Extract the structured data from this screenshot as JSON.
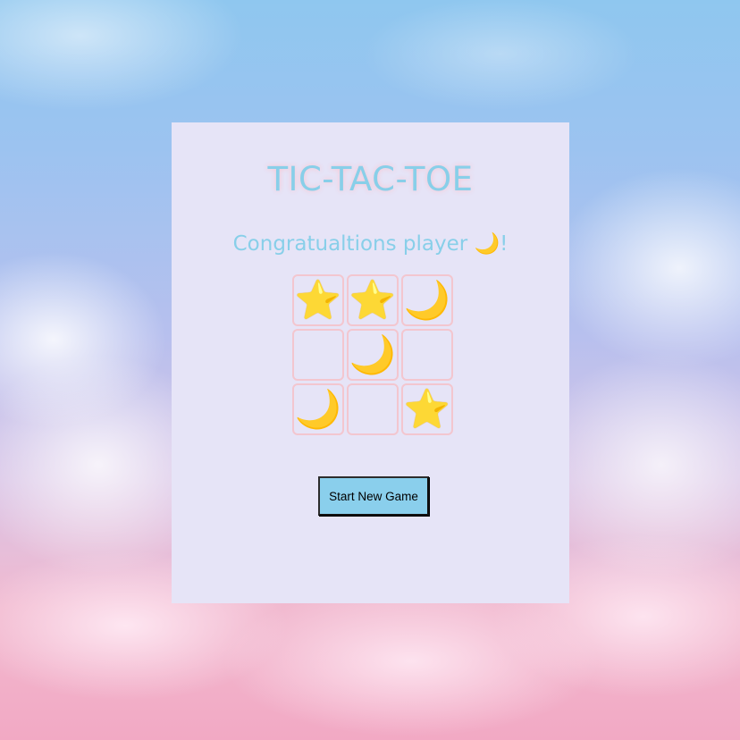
{
  "game": {
    "title": "TIC-TAC-TOE",
    "status_message": "Congratualtions player 🌙!",
    "board": [
      {
        "mark": "⭐",
        "kind": "star"
      },
      {
        "mark": "⭐",
        "kind": "star"
      },
      {
        "mark": "🌙",
        "kind": "moon"
      },
      {
        "mark": "",
        "kind": "empty"
      },
      {
        "mark": "🌙",
        "kind": "moon"
      },
      {
        "mark": "",
        "kind": "empty"
      },
      {
        "mark": "🌙",
        "kind": "moon"
      },
      {
        "mark": "",
        "kind": "empty"
      },
      {
        "mark": "⭐",
        "kind": "star"
      }
    ],
    "new_game_label": "Start New Game"
  },
  "theme": {
    "accent": "#88cfe9",
    "card_background": "#e6e4f7",
    "cell_border": "#f3c6cf",
    "button_background": "#8acfec"
  }
}
